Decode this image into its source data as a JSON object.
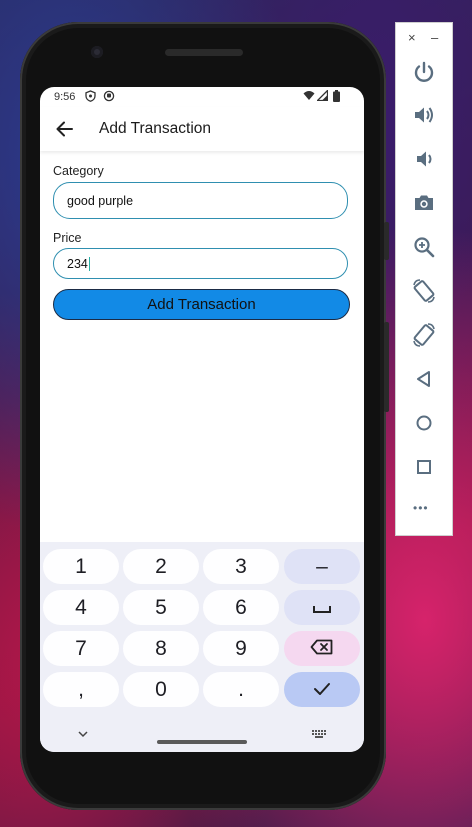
{
  "status_bar": {
    "time": "9:56"
  },
  "app_bar": {
    "title": "Add Transaction"
  },
  "form": {
    "category_label": "Category",
    "category_value": "good purple",
    "price_label": "Price",
    "price_value": "234",
    "submit_label": "Add Transaction"
  },
  "keyboard": {
    "rows": [
      [
        "1",
        "2",
        "3",
        "–"
      ],
      [
        "4",
        "5",
        "6",
        "␣"
      ],
      [
        "7",
        "8",
        "9",
        "⌫"
      ],
      [
        ",",
        "0",
        ".",
        "✓"
      ]
    ]
  },
  "emulator_toolbar": {
    "close": "×",
    "minimize": "–",
    "more": "•••",
    "buttons": [
      "power-icon",
      "volume-up-icon",
      "volume-down-icon",
      "camera-icon",
      "zoom-icon",
      "rotate-left-icon",
      "rotate-right-icon",
      "back-icon",
      "home-icon",
      "overview-icon"
    ]
  },
  "colors": {
    "accent_button": "#128ae6",
    "field_border": "#2f8fb0",
    "keyboard_bg": "#eeeff7"
  }
}
